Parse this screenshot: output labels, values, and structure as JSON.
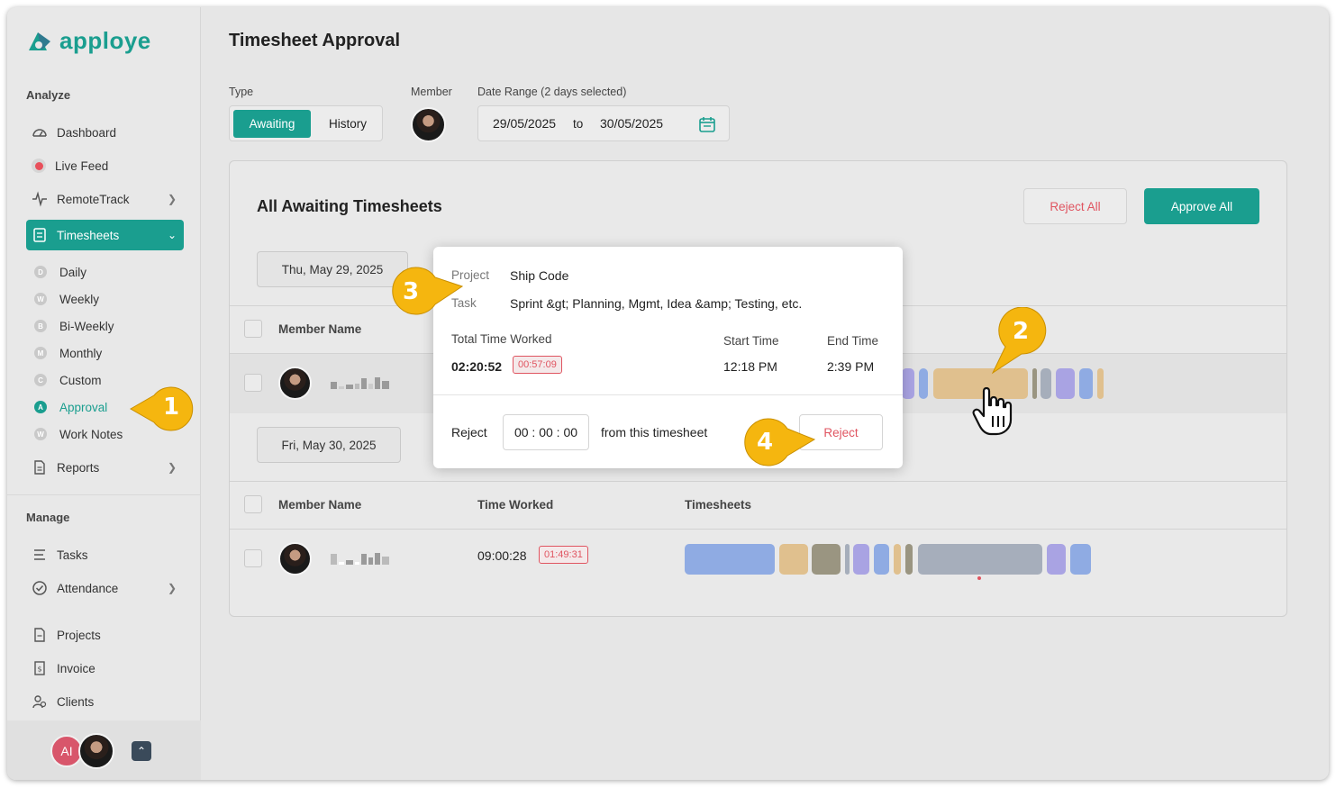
{
  "app": {
    "name": "apploye"
  },
  "sidebar": {
    "analyze_label": "Analyze",
    "manage_label": "Manage",
    "items": [
      {
        "label": "Dashboard",
        "icon": "dashboard-icon"
      },
      {
        "label": "Live Feed",
        "icon": "live-dot-icon"
      },
      {
        "label": "RemoteTrack",
        "icon": "pulse-icon"
      },
      {
        "label": "Timesheets",
        "icon": "timesheet-icon"
      },
      {
        "label": "Reports",
        "icon": "report-icon"
      }
    ],
    "timesheet_subitems": [
      {
        "letter": "D",
        "label": "Daily"
      },
      {
        "letter": "W",
        "label": "Weekly"
      },
      {
        "letter": "B",
        "label": "Bi-Weekly"
      },
      {
        "letter": "M",
        "label": "Monthly"
      },
      {
        "letter": "C",
        "label": "Custom"
      },
      {
        "letter": "A",
        "label": "Approval"
      },
      {
        "letter": "W",
        "label": "Work Notes"
      }
    ],
    "manage_items": [
      {
        "label": "Tasks",
        "icon": "tasks-icon"
      },
      {
        "label": "Attendance",
        "icon": "attendance-icon"
      },
      {
        "label": "Projects",
        "icon": "project-icon"
      },
      {
        "label": "Invoice",
        "icon": "invoice-icon"
      },
      {
        "label": "Clients",
        "icon": "clients-icon"
      }
    ],
    "user_initials": "AI"
  },
  "header": {
    "title": "Timesheet Approval",
    "type_label": "Type",
    "type_options": [
      "Awaiting",
      "History"
    ],
    "member_label": "Member",
    "date_range_label": "Date Range (2 days selected)",
    "date_from": "29/05/2025",
    "date_to_word": "to",
    "date_to": "30/05/2025"
  },
  "card": {
    "title": "All Awaiting Timesheets",
    "reject_all": "Reject All",
    "approve_all": "Approve All",
    "days": [
      {
        "date": "Thu, May 29, 2025",
        "col_member": "Member Name",
        "time_worked": "",
        "idle_badge": ""
      },
      {
        "date": "Fri, May 30, 2025",
        "col_member": "Member Name",
        "col_time": "Time Worked",
        "col_timesheets": "Timesheets",
        "time_worked": "09:00:28",
        "idle_badge": "01:49:31"
      }
    ]
  },
  "popup": {
    "project_label": "Project",
    "project_value": "Ship Code",
    "task_label": "Task",
    "task_value": "Sprint &gt; Planning, Mgmt, Idea &amp; Testing, etc.",
    "total_label": "Total Time Worked",
    "total_value": "02:20:52",
    "idle_badge": "00:57:09",
    "start_label": "Start Time",
    "start_value": "12:18 PM",
    "end_label": "End Time",
    "end_value": "2:39 PM",
    "reject_label": "Reject",
    "time_input_value": "00 : 00 : 00",
    "from_text": "from this timesheet",
    "reject_button": "Reject"
  },
  "callouts": [
    "1",
    "2",
    "3",
    "4"
  ],
  "colors": {
    "accent": "#1a9e8f",
    "danger": "#e05561",
    "callout": "#f5b60f",
    "seg_blue": "#8fabe3",
    "seg_tan": "#e0c08e",
    "seg_olive": "#9a9581",
    "seg_purple": "#a9a3e3",
    "seg_gray": "#a6aebb"
  }
}
